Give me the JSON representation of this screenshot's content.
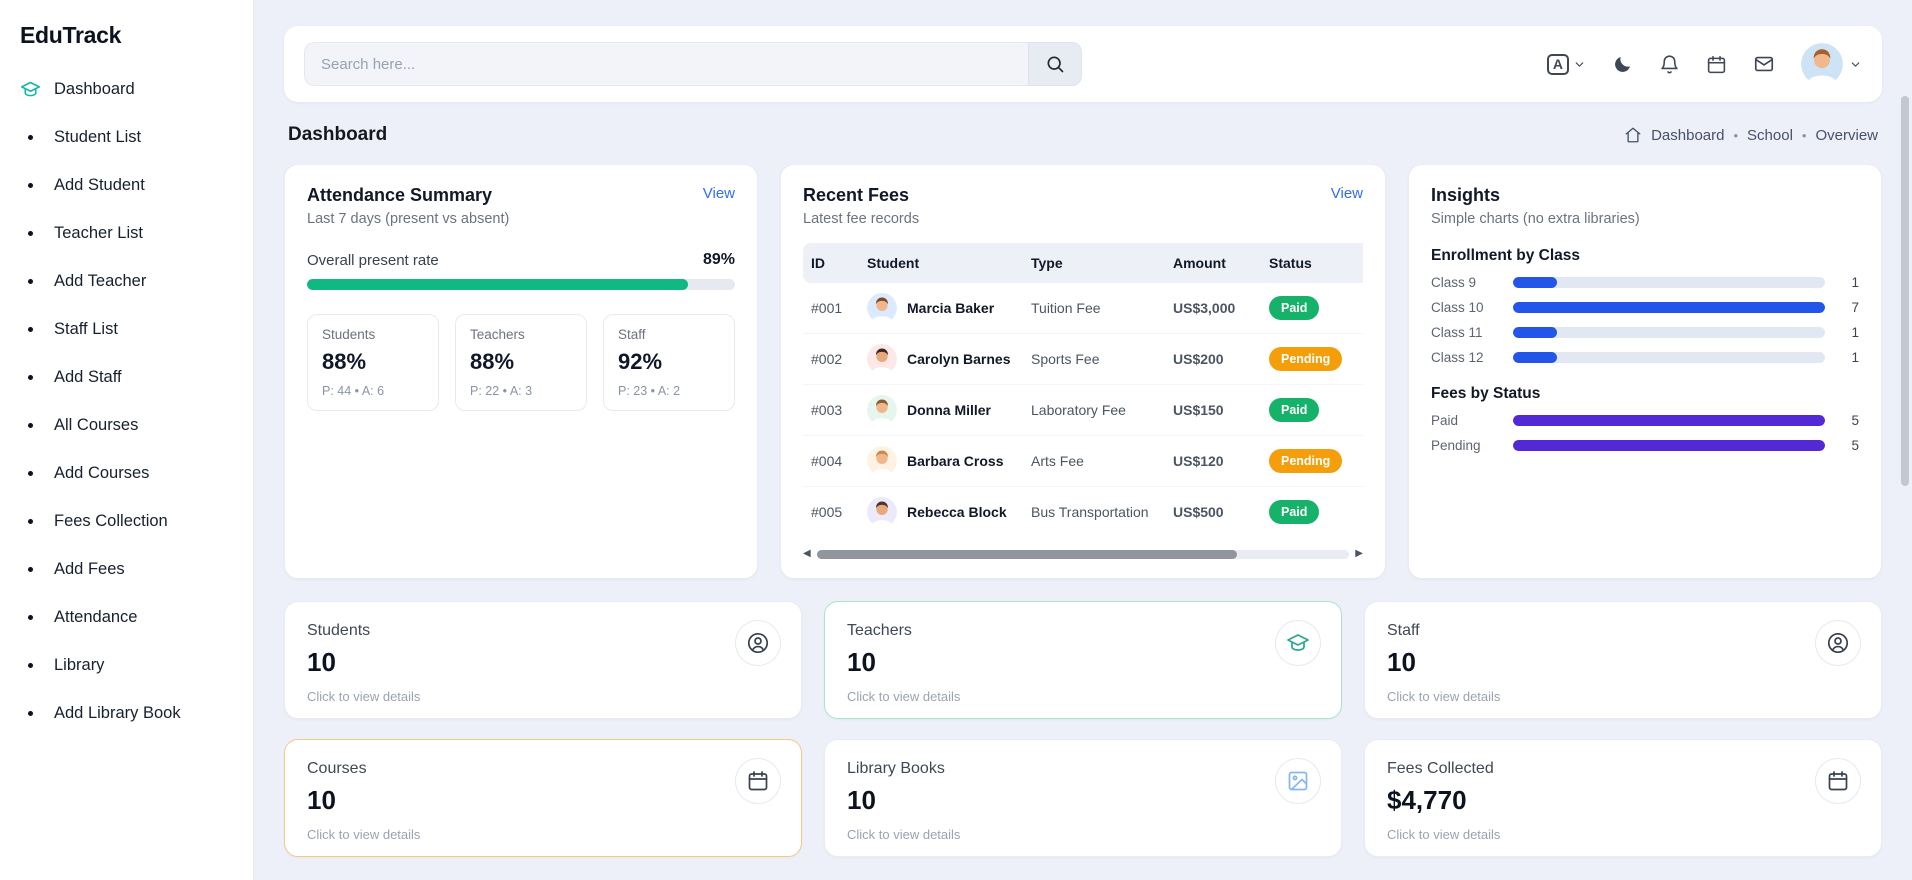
{
  "app": {
    "name": "EduTrack"
  },
  "colors": {
    "link_blue": "#2f6fed",
    "progress_green": "#10b981",
    "sidebar_accent": "#14b8a6"
  },
  "sidebar": {
    "items": [
      {
        "label": "Dashboard"
      },
      {
        "label": "Student List"
      },
      {
        "label": "Add Student"
      },
      {
        "label": "Teacher List"
      },
      {
        "label": "Add Teacher"
      },
      {
        "label": "Staff List"
      },
      {
        "label": "Add Staff"
      },
      {
        "label": "All Courses"
      },
      {
        "label": "Add Courses"
      },
      {
        "label": "Fees Collection"
      },
      {
        "label": "Add Fees"
      },
      {
        "label": "Attendance"
      },
      {
        "label": "Library"
      },
      {
        "label": "Add Library Book"
      }
    ]
  },
  "topbar": {
    "search_placeholder": "Search here..."
  },
  "breadcrumb": {
    "page_title": "Dashboard",
    "items": [
      "Dashboard",
      "School",
      "Overview"
    ]
  },
  "attendance": {
    "title": "Attendance Summary",
    "view_label": "View",
    "subtitle": "Last 7 days (present vs absent)",
    "overall_label": "Overall present rate",
    "overall_value": "89%",
    "overall_pct": 89,
    "groups": [
      {
        "label": "Students",
        "value": "88%",
        "detail": "P: 44 • A: 6"
      },
      {
        "label": "Teachers",
        "value": "88%",
        "detail": "P: 22 • A: 3"
      },
      {
        "label": "Staff",
        "value": "92%",
        "detail": "P: 23 • A: 2"
      }
    ]
  },
  "recent_fees": {
    "title": "Recent Fees",
    "view_label": "View",
    "subtitle": "Latest fee records",
    "columns": {
      "id": "ID",
      "student": "Student",
      "type": "Type",
      "amount": "Amount",
      "status": "Status"
    },
    "rows": [
      {
        "id": "#001",
        "student": "Marcia Baker",
        "type": "Tuition Fee",
        "amount": "US$3,000",
        "status": "Paid",
        "status_color": "#17b26a",
        "hair": "#7a4a2b"
      },
      {
        "id": "#002",
        "student": "Carolyn Barnes",
        "type": "Sports Fee",
        "amount": "US$200",
        "status": "Pending",
        "status_color": "#f59e0b",
        "hair": "#3b2a20"
      },
      {
        "id": "#003",
        "student": "Donna Miller",
        "type": "Laboratory Fee",
        "amount": "US$150",
        "status": "Paid",
        "status_color": "#17b26a",
        "hair": "#8a5a33"
      },
      {
        "id": "#004",
        "student": "Barbara Cross",
        "type": "Arts Fee",
        "amount": "US$120",
        "status": "Pending",
        "status_color": "#f59e0b",
        "hair": "#c98a4b"
      },
      {
        "id": "#005",
        "student": "Rebecca Block",
        "type": "Bus Transportation",
        "amount": "US$500",
        "status": "Paid",
        "status_color": "#17b26a",
        "hair": "#4a3526"
      }
    ]
  },
  "insights": {
    "title": "Insights",
    "subtitle": "Simple charts (no extra libraries)",
    "enrollment": {
      "title": "Enrollment by Class",
      "bar_color": "#2356e8",
      "max": 7,
      "rows": [
        {
          "label": "Class 9",
          "value": 1,
          "pct": 14
        },
        {
          "label": "Class 10",
          "value": 7,
          "pct": 100
        },
        {
          "label": "Class 11",
          "value": 1,
          "pct": 14
        },
        {
          "label": "Class 12",
          "value": 1,
          "pct": 14
        }
      ]
    },
    "fees_by_status": {
      "title": "Fees by Status",
      "bar_color": "#5329d6",
      "max": 5,
      "rows": [
        {
          "label": "Paid",
          "value": 5,
          "pct": 100
        },
        {
          "label": "Pending",
          "value": 5,
          "pct": 100
        }
      ]
    }
  },
  "summary_cards": [
    {
      "label": "Students",
      "value": "10",
      "hint": "Click to view details",
      "icon": "user-icon",
      "icon_color": "#394150",
      "accent": "#e9ecf2"
    },
    {
      "label": "Teachers",
      "value": "10",
      "hint": "Click to view details",
      "icon": "graduation-cap-icon",
      "icon_color": "#2aa88d",
      "accent": "#a9e3cf"
    },
    {
      "label": "Staff",
      "value": "10",
      "hint": "Click to view details",
      "icon": "user-icon",
      "icon_color": "#394150",
      "accent": "#e9ecf2"
    },
    {
      "label": "Courses",
      "value": "10",
      "hint": "Click to view details",
      "icon": "calendar-icon",
      "icon_color": "#394150",
      "accent": "#f4ca82"
    },
    {
      "label": "Library Books",
      "value": "10",
      "hint": "Click to view details",
      "icon": "image-icon",
      "icon_color": "#85b6f2",
      "accent": "#e9ecf2"
    },
    {
      "label": "Fees Collected",
      "value": "$4,770",
      "hint": "Click to view details",
      "icon": "calendar-icon",
      "icon_color": "#394150",
      "accent": "#e9ecf2"
    }
  ]
}
